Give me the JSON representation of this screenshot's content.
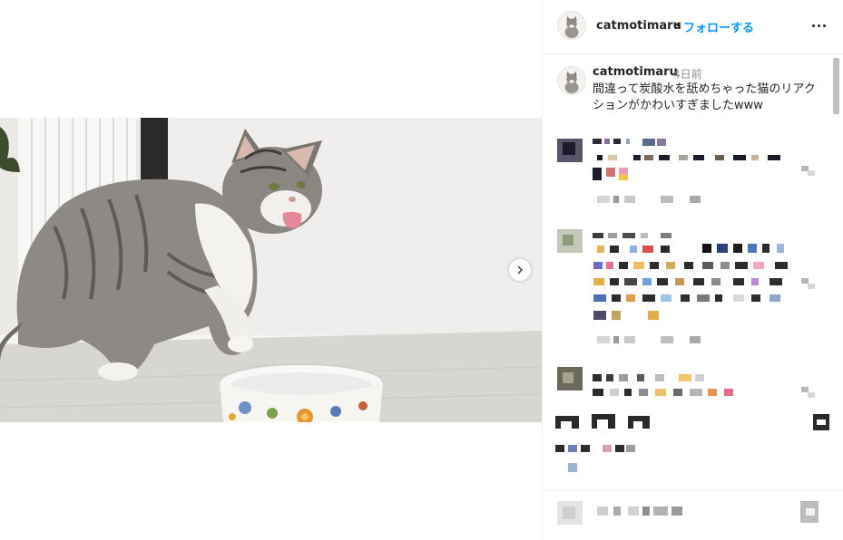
{
  "post": {
    "username": "catmotimaru",
    "separator": "•",
    "follow_label": "フォローする",
    "more_icon": "more-horizontal-icon"
  },
  "caption": {
    "username": "catmotimaru",
    "time": "4日前",
    "text": "間違って炭酸水を舐めちゃった猫のリアクションがかわいすぎましたwww"
  },
  "media": {
    "next_icon": "chevron-right-icon",
    "image_subject": "cat-drinking-photo"
  },
  "comments": {
    "redacted": true
  }
}
